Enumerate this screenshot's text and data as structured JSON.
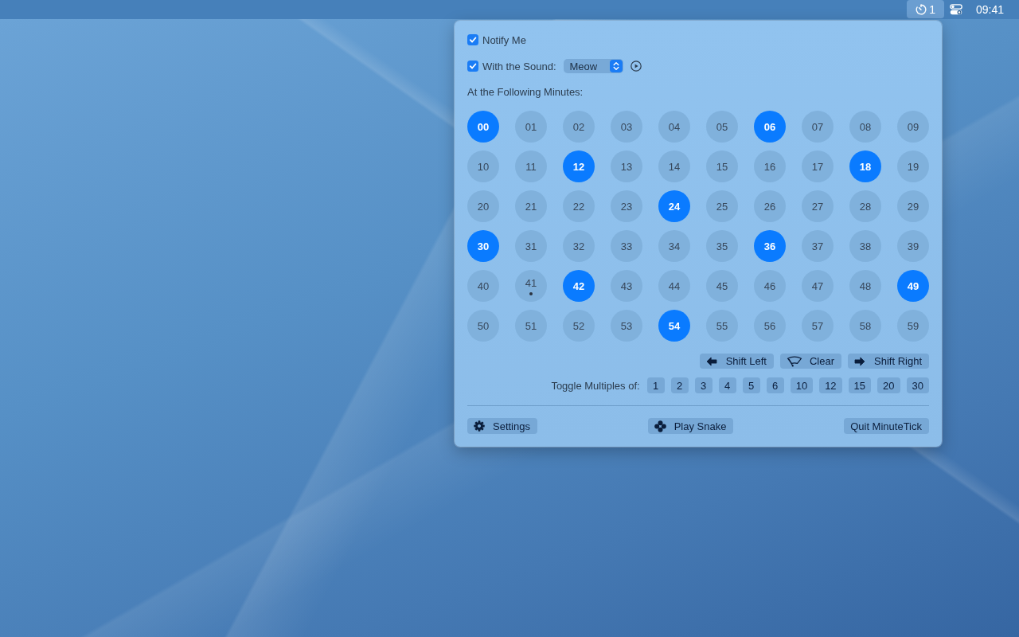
{
  "menu_bar": {
    "status_item": {
      "label": "1",
      "selected": true
    },
    "clock": "09:41"
  },
  "notify": {
    "label": "Notify Me",
    "checked": true
  },
  "sound": {
    "label": "With the Sound:",
    "checked": true,
    "value": "Meow"
  },
  "minutes_label": "At the Following Minutes:",
  "minutes": [
    {
      "label": "00",
      "selected": true,
      "current": false
    },
    {
      "label": "01",
      "selected": false,
      "current": false
    },
    {
      "label": "02",
      "selected": false,
      "current": false
    },
    {
      "label": "03",
      "selected": false,
      "current": false
    },
    {
      "label": "04",
      "selected": false,
      "current": false
    },
    {
      "label": "05",
      "selected": false,
      "current": false
    },
    {
      "label": "06",
      "selected": true,
      "current": false
    },
    {
      "label": "07",
      "selected": false,
      "current": false
    },
    {
      "label": "08",
      "selected": false,
      "current": false
    },
    {
      "label": "09",
      "selected": false,
      "current": false
    },
    {
      "label": "10",
      "selected": false,
      "current": false
    },
    {
      "label": "11",
      "selected": false,
      "current": false
    },
    {
      "label": "12",
      "selected": true,
      "current": false
    },
    {
      "label": "13",
      "selected": false,
      "current": false
    },
    {
      "label": "14",
      "selected": false,
      "current": false
    },
    {
      "label": "15",
      "selected": false,
      "current": false
    },
    {
      "label": "16",
      "selected": false,
      "current": false
    },
    {
      "label": "17",
      "selected": false,
      "current": false
    },
    {
      "label": "18",
      "selected": true,
      "current": false
    },
    {
      "label": "19",
      "selected": false,
      "current": false
    },
    {
      "label": "20",
      "selected": false,
      "current": false
    },
    {
      "label": "21",
      "selected": false,
      "current": false
    },
    {
      "label": "22",
      "selected": false,
      "current": false
    },
    {
      "label": "23",
      "selected": false,
      "current": false
    },
    {
      "label": "24",
      "selected": true,
      "current": false
    },
    {
      "label": "25",
      "selected": false,
      "current": false
    },
    {
      "label": "26",
      "selected": false,
      "current": false
    },
    {
      "label": "27",
      "selected": false,
      "current": false
    },
    {
      "label": "28",
      "selected": false,
      "current": false
    },
    {
      "label": "29",
      "selected": false,
      "current": false
    },
    {
      "label": "30",
      "selected": true,
      "current": false
    },
    {
      "label": "31",
      "selected": false,
      "current": false
    },
    {
      "label": "32",
      "selected": false,
      "current": false
    },
    {
      "label": "33",
      "selected": false,
      "current": false
    },
    {
      "label": "34",
      "selected": false,
      "current": false
    },
    {
      "label": "35",
      "selected": false,
      "current": false
    },
    {
      "label": "36",
      "selected": true,
      "current": false
    },
    {
      "label": "37",
      "selected": false,
      "current": false
    },
    {
      "label": "38",
      "selected": false,
      "current": false
    },
    {
      "label": "39",
      "selected": false,
      "current": false
    },
    {
      "label": "40",
      "selected": false,
      "current": false
    },
    {
      "label": "41",
      "selected": false,
      "current": true
    },
    {
      "label": "42",
      "selected": true,
      "current": false
    },
    {
      "label": "43",
      "selected": false,
      "current": false
    },
    {
      "label": "44",
      "selected": false,
      "current": false
    },
    {
      "label": "45",
      "selected": false,
      "current": false
    },
    {
      "label": "46",
      "selected": false,
      "current": false
    },
    {
      "label": "47",
      "selected": false,
      "current": false
    },
    {
      "label": "48",
      "selected": false,
      "current": false
    },
    {
      "label": "49",
      "selected": true,
      "current": false
    },
    {
      "label": "50",
      "selected": false,
      "current": false
    },
    {
      "label": "51",
      "selected": false,
      "current": false
    },
    {
      "label": "52",
      "selected": false,
      "current": false
    },
    {
      "label": "53",
      "selected": false,
      "current": false
    },
    {
      "label": "54",
      "selected": true,
      "current": false
    },
    {
      "label": "55",
      "selected": false,
      "current": false
    },
    {
      "label": "56",
      "selected": false,
      "current": false
    },
    {
      "label": "57",
      "selected": false,
      "current": false
    },
    {
      "label": "58",
      "selected": false,
      "current": false
    },
    {
      "label": "59",
      "selected": false,
      "current": false
    }
  ],
  "actions": [
    {
      "kind": "shift-left",
      "label": "Shift Left"
    },
    {
      "kind": "clear",
      "label": "Clear"
    },
    {
      "kind": "shift-right",
      "label": "Shift Right"
    }
  ],
  "multiples": {
    "label": "Toggle Multiples of:",
    "values": [
      "1",
      "2",
      "3",
      "4",
      "5",
      "6",
      "10",
      "12",
      "15",
      "20",
      "30"
    ]
  },
  "footer": [
    {
      "kind": "settings",
      "label": "Settings"
    },
    {
      "kind": "snake",
      "label": "Play Snake"
    },
    {
      "kind": "quit",
      "label": "Quit MinuteTick"
    }
  ]
}
